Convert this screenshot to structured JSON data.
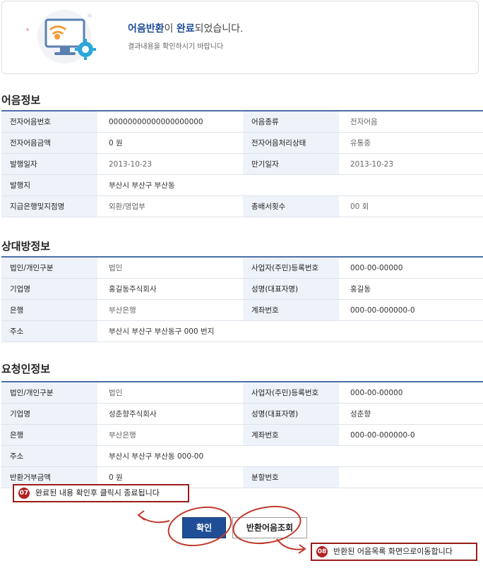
{
  "banner": {
    "title_em1": "어음반환",
    "title_mid": "이 ",
    "title_em2": "완료",
    "title_rest": "되었습니다.",
    "subtitle": "결과내용을 확인하시기 바랍니다",
    "icon": "monitor-wifi-gear-icon"
  },
  "sections": {
    "note": {
      "title": "어음정보"
    },
    "counterparty": {
      "title": "상대방정보"
    },
    "requester": {
      "title": "요청인정보"
    }
  },
  "note": {
    "r1": {
      "l1": "전자어음번호",
      "v1": "00000000000000000000",
      "l2": "어음종류",
      "v2": "전자어음"
    },
    "r2": {
      "l1": "전자어음금액",
      "v1": "0 원",
      "l2": "전자어음처리상태",
      "v2": "유통중"
    },
    "r3": {
      "l1": "발행일자",
      "v1": "2013-10-23",
      "l2": "만기일자",
      "v2": "2013-10-23"
    },
    "r4": {
      "l1": "발행지",
      "v1": "부산시 부산구 부산동"
    },
    "r5": {
      "l1": "지급은행및지점명",
      "v1": "외환/영업부",
      "l2": "총배서횟수",
      "v2": "00 회"
    }
  },
  "counterparty": {
    "r1": {
      "l1": "법인/개인구분",
      "v1": "법인",
      "l2": "사업자(주민)등록번호",
      "v2": "000-00-00000"
    },
    "r2": {
      "l1": "기업명",
      "v1": "홍길동주식회사",
      "l2": "성명(대표자명)",
      "v2": "홍길동"
    },
    "r3": {
      "l1": "은행",
      "v1": "부산은행",
      "l2": "계좌번호",
      "v2": "000-00-000000-0"
    },
    "r4": {
      "l1": "주소",
      "v1": "부산시 부산구 부산동구 000 번지"
    }
  },
  "requester": {
    "r1": {
      "l1": "법인/개인구분",
      "v1": "법인",
      "l2": "사업자(주민)등록번호",
      "v2": "000-00-00000"
    },
    "r2": {
      "l1": "기업명",
      "v1": "성춘향주식회사",
      "l2": "성명(대표자명)",
      "v2": "성춘향"
    },
    "r3": {
      "l1": "은행",
      "v1": "부산은행",
      "l2": "계좌번호",
      "v2": "000-00-000000-0"
    },
    "r4": {
      "l1": "주소",
      "v1": "부산시 부산구 부산동  000-00"
    },
    "r5": {
      "l1": "반환거부금액",
      "v1": "0 원",
      "l2": "분할번호",
      "v2": ""
    }
  },
  "buttons": {
    "confirm": "확인",
    "return_list": "반환어음조회"
  },
  "callouts": {
    "c07": {
      "num": "07",
      "text": "완료된 내용 확인후 클릭시 종료됩니다"
    },
    "c08": {
      "num": "08",
      "text": "반환된 어음목록 화면으로이동합니다"
    }
  },
  "colors": {
    "accent": "#1f4e96",
    "label_bg": "#eef3f9",
    "callout_border": "#9b1b1b",
    "annotation": "#c0392b"
  }
}
